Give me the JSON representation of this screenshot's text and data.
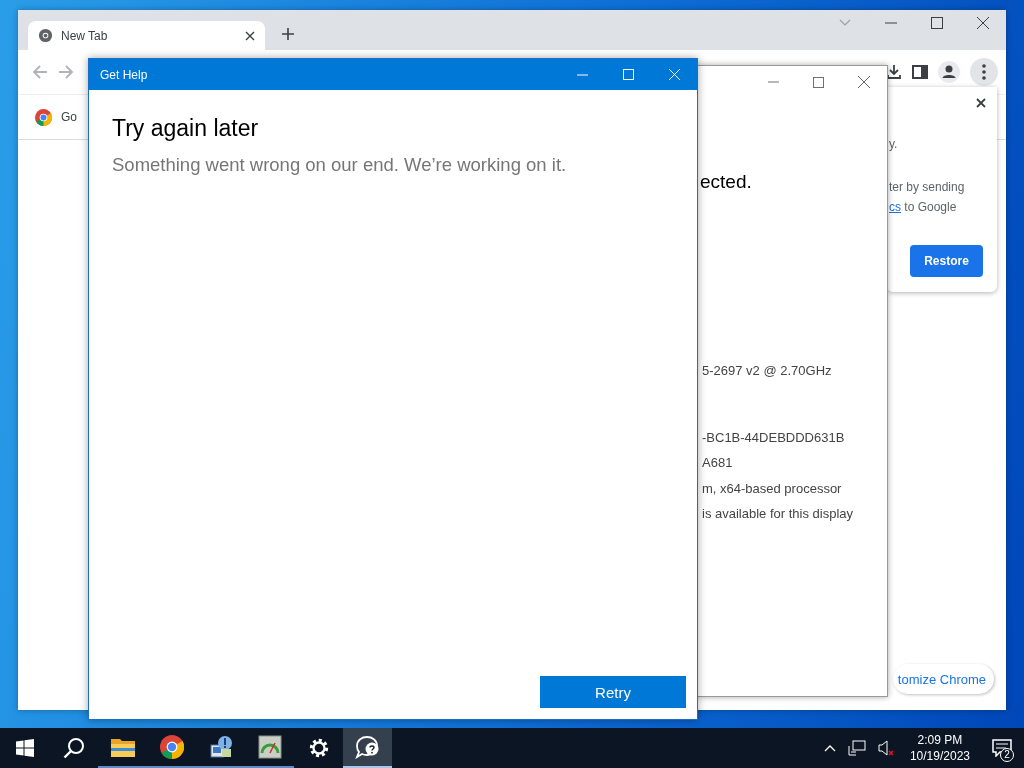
{
  "chrome": {
    "tabs": [
      {
        "title": "New Tab",
        "selected": true
      }
    ],
    "bookmark": "Go",
    "popup": {
      "top_line": "y.",
      "text_lines": [
        "ter by sending"
      ],
      "link": "cs",
      "after_link": " to Google",
      "button": "Restore"
    },
    "customize_button": "tomize Chrome"
  },
  "info_window": {
    "heading": "ected.",
    "lines": [
      "5-2697 v2 @ 2.70GHz",
      "-BC1B-44DEBDDD631B",
      "A681",
      "m, x64-based processor",
      "is available for this display"
    ]
  },
  "help_window": {
    "title": "Get Help",
    "heading": "Try again later",
    "message": "Something went wrong on our end. We’re working on it.",
    "button": "Retry"
  },
  "taskbar": {
    "apps": [
      {
        "kind": "folder",
        "running": true,
        "selected": false
      },
      {
        "kind": "chrome",
        "running": true,
        "selected": false
      },
      {
        "kind": "system",
        "running": true,
        "selected": false
      },
      {
        "kind": "gauge",
        "running": true,
        "selected": false
      },
      {
        "kind": "settings",
        "running": false,
        "selected": false
      },
      {
        "kind": "help",
        "running": true,
        "selected": true
      }
    ],
    "clock": {
      "time": "2:09 PM",
      "date": "10/19/2023"
    },
    "notifications": "2"
  }
}
